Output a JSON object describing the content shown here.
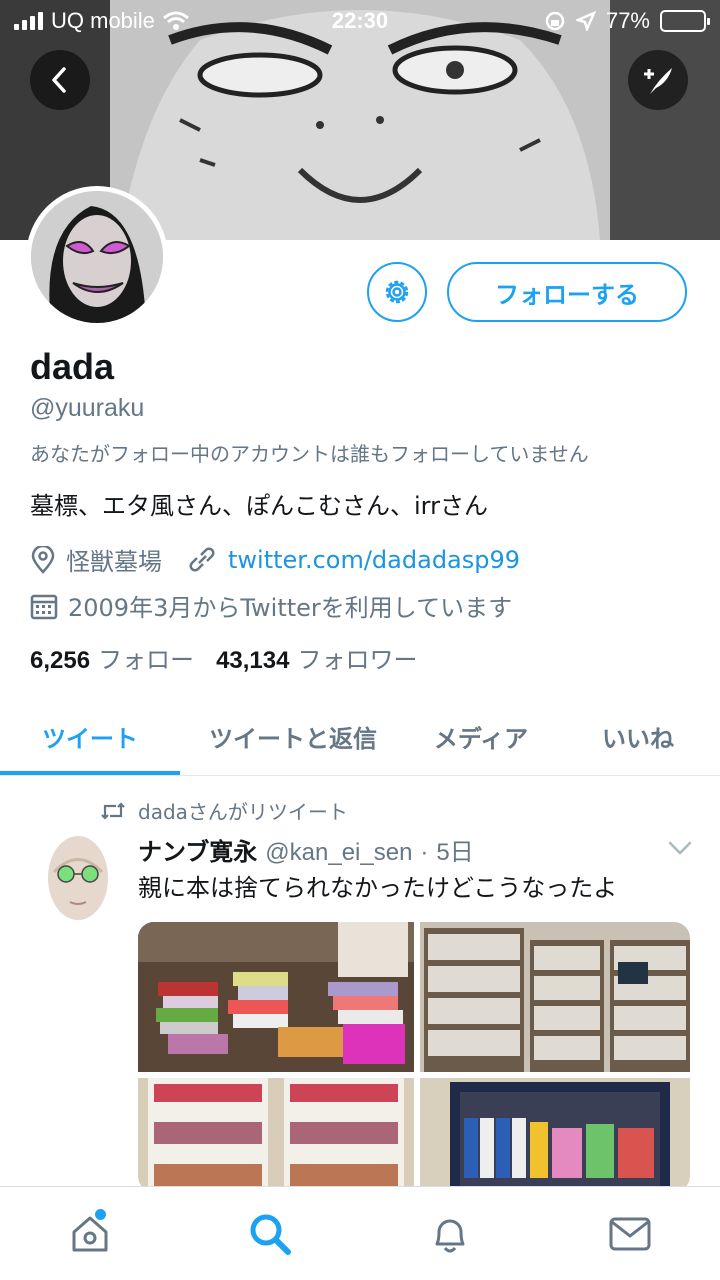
{
  "status_bar": {
    "carrier": "UQ mobile",
    "time": "22:30",
    "battery": "77%",
    "battery_level": 0.77
  },
  "profile": {
    "name": "dada",
    "handle": "@yuuraku",
    "not_followed_note": "あなたがフォロー中のアカウントは誰もフォローしていません",
    "bio": "墓標、エタ風さん、ぽんこむさん、irrさん",
    "location": "怪獣墓場",
    "website": "twitter.com/dadadasp99",
    "joined": "2009年3月からTwitterを利用しています",
    "following_count": "6,256",
    "following_label": "フォロー",
    "followers_count": "43,134",
    "followers_label": "フォロワー",
    "follow_button_label": "フォローする"
  },
  "tabs": [
    {
      "label": "ツイート",
      "active": true
    },
    {
      "label": "ツイートと返信",
      "active": false
    },
    {
      "label": "メディア",
      "active": false
    },
    {
      "label": "いいね",
      "active": false
    }
  ],
  "tweet": {
    "retweet_note": "dadaさんがリツイート",
    "author_name": "ナンブ寛永",
    "author_handle": "@kan_ei_sen",
    "separator": "·",
    "age": "5日",
    "text": "親に本は捨てられなかったけどこうなったよ"
  },
  "icons": {
    "back": "back-arrow-icon",
    "compose": "compose-tweet-icon",
    "settings": "gear-icon",
    "location": "location-pin-icon",
    "link": "link-icon",
    "calendar": "calendar-icon",
    "retweet": "retweet-icon",
    "caret": "chevron-down-icon",
    "nav": [
      "home-icon",
      "search-icon",
      "notifications-icon",
      "messages-icon"
    ]
  },
  "colors": {
    "accent": "#1da1f2",
    "link": "#1b95e0",
    "secondary_text": "#657786",
    "primary_text": "#14171a"
  }
}
